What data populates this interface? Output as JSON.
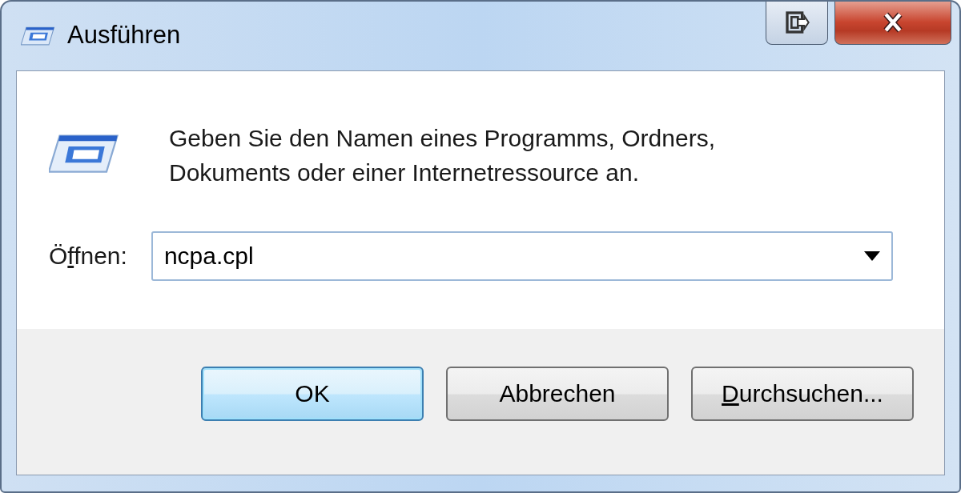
{
  "window": {
    "title": "Ausführen"
  },
  "prompt": {
    "lines": [
      "Geben Sie den Namen eines Programms, Ordners,",
      "Dokuments oder einer Internetressource an."
    ]
  },
  "open_field": {
    "label": [
      {
        "text": "Ö",
        "underline": false
      },
      {
        "text": "f",
        "underline": true
      },
      {
        "text": "fnen:",
        "underline": false
      }
    ],
    "value": "ncpa.cpl"
  },
  "buttons": [
    {
      "label": [
        {
          "text": "OK",
          "underline": false
        }
      ],
      "default": true
    },
    {
      "label": [
        {
          "text": "Abbrechen",
          "underline": false
        }
      ],
      "default": false
    },
    {
      "label": [
        {
          "text": "D",
          "underline": true
        },
        {
          "text": "urchsuchen...",
          "underline": false
        }
      ],
      "default": false
    }
  ]
}
